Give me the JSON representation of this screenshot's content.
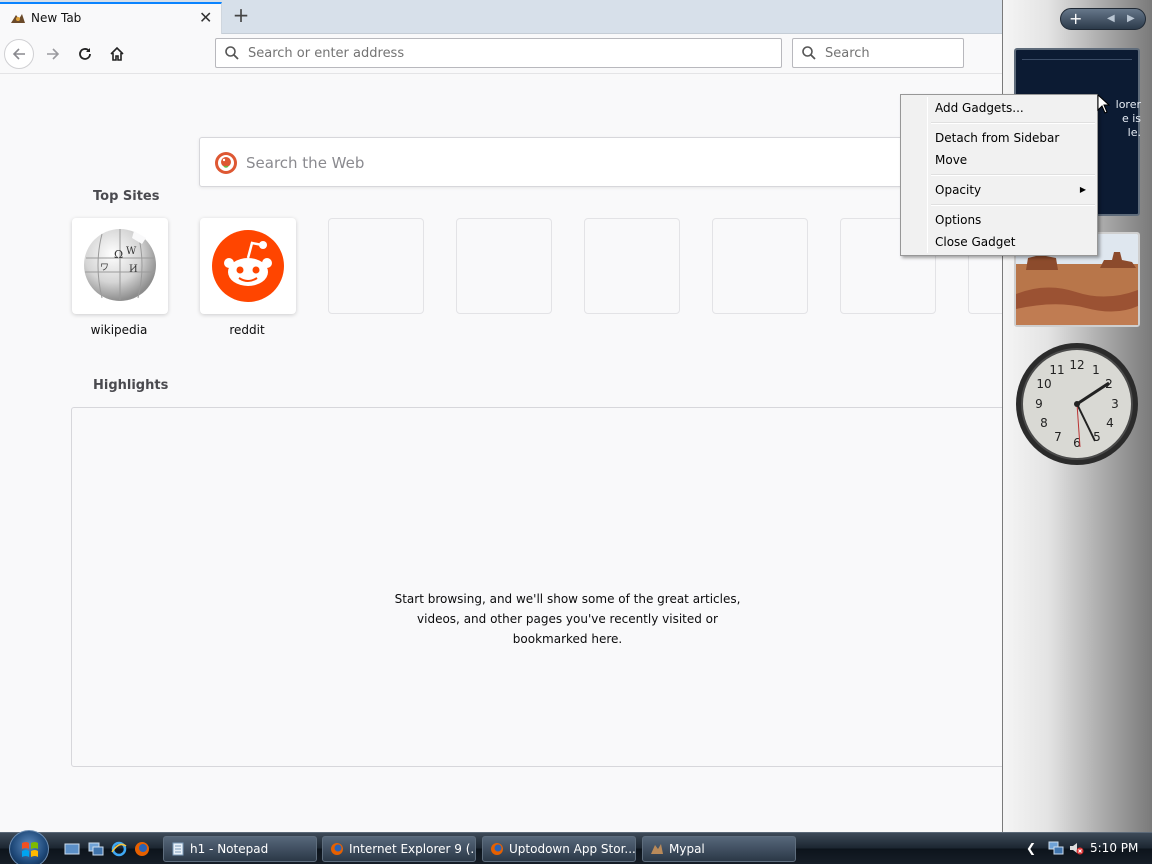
{
  "browser": {
    "tab": {
      "title": "New Tab",
      "close_glyph": "✕"
    },
    "new_tab_glyph": "+",
    "nav": {
      "back_icon": "arrow-left-icon",
      "forward_icon": "arrow-right-icon",
      "reload_icon": "reload-icon",
      "home_icon": "home-icon"
    },
    "urlbar": {
      "placeholder": "Search or enter address",
      "value": ""
    },
    "searchbar": {
      "placeholder": "Search",
      "value": ""
    }
  },
  "newtab": {
    "websearch_placeholder": "Search the Web",
    "top_sites_title": "Top Sites",
    "top_sites": [
      {
        "label": "wikipedia",
        "icon": "wikipedia-globe-icon"
      },
      {
        "label": "reddit",
        "icon": "reddit-alien-icon"
      }
    ],
    "highlights_title": "Highlights",
    "highlights_message": "Start browsing, and we'll show some of the great articles, videos, and other pages you've recently visited or bookmarked here."
  },
  "gadgets": {
    "feed_partial_text": "lorer\ne is\nle.",
    "clock_numerals": [
      "12",
      "1",
      "2",
      "3",
      "4",
      "5",
      "6",
      "7",
      "8",
      "9",
      "10",
      "11"
    ]
  },
  "context_menu": {
    "items": [
      {
        "label": "Add Gadgets..."
      },
      {
        "label": "Detach from Sidebar"
      },
      {
        "label": "Move"
      },
      {
        "label": "Opacity",
        "has_submenu": true
      },
      {
        "label": "Options"
      },
      {
        "label": "Close Gadget"
      }
    ]
  },
  "taskbar": {
    "buttons": [
      {
        "label": "h1 - Notepad",
        "icon": "notepad-icon"
      },
      {
        "label": "Internet Explorer 9 (...",
        "icon": "firefox-icon"
      },
      {
        "label": "Uptodown App Stor...",
        "icon": "firefox-icon"
      },
      {
        "label": "Mypal",
        "icon": "mypal-icon"
      }
    ],
    "clock": "5:10 PM"
  },
  "colors": {
    "accent": "#0a84ff",
    "reddit": "#ff4500",
    "taskbar": "#1c2631"
  }
}
